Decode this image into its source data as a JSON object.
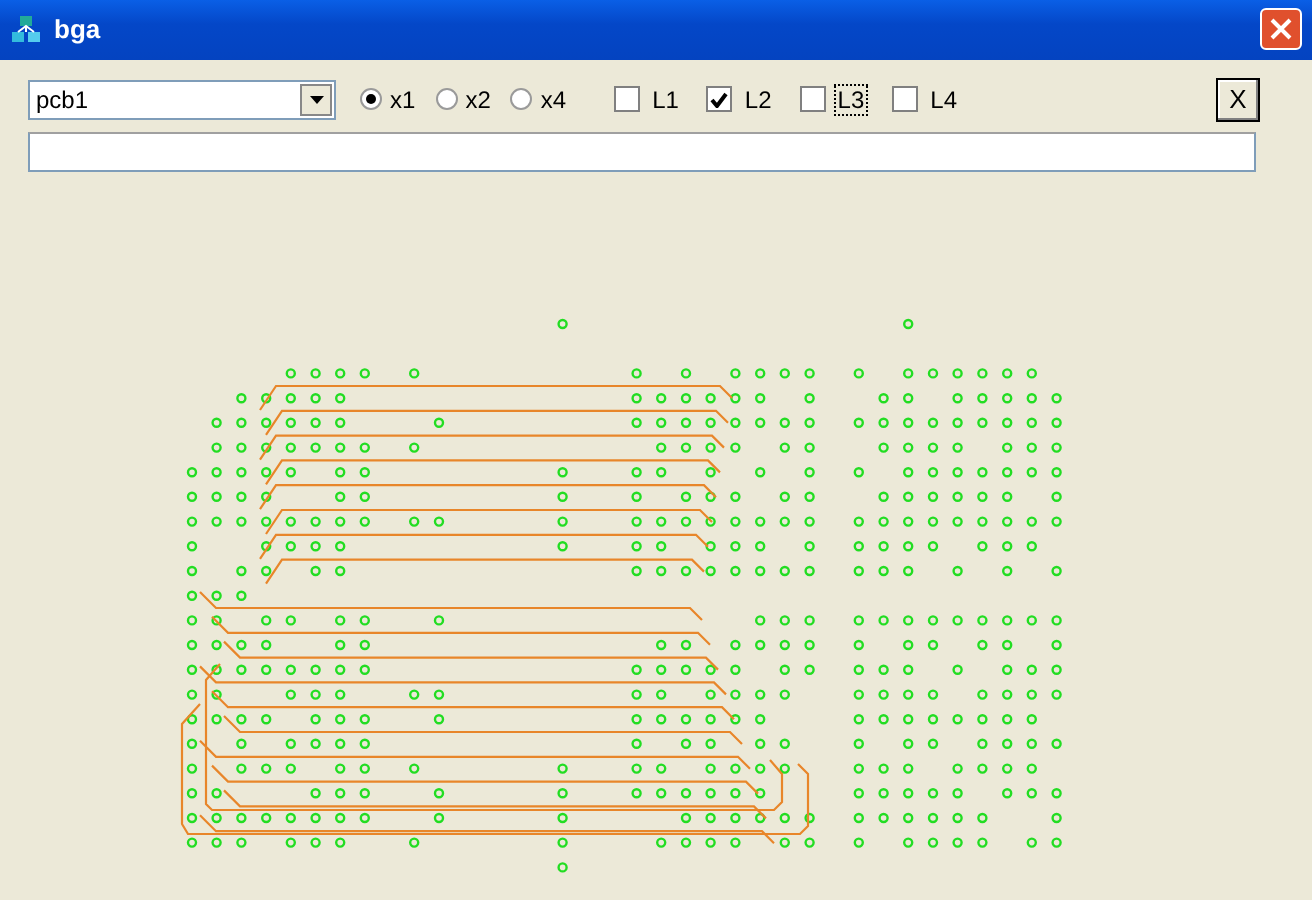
{
  "window": {
    "title": "bga"
  },
  "board_select": {
    "value": "pcb1"
  },
  "zoom_options": [
    {
      "label": "x1",
      "selected": true
    },
    {
      "label": "x2",
      "selected": false
    },
    {
      "label": "x4",
      "selected": false
    }
  ],
  "layers": [
    {
      "label": "L1",
      "checked": false,
      "focused": false
    },
    {
      "label": "L2",
      "checked": true,
      "focused": false
    },
    {
      "label": "L3",
      "checked": false,
      "focused": true
    },
    {
      "label": "L4",
      "checked": false,
      "focused": false
    }
  ],
  "close_panel_button": {
    "label": "X"
  }
}
